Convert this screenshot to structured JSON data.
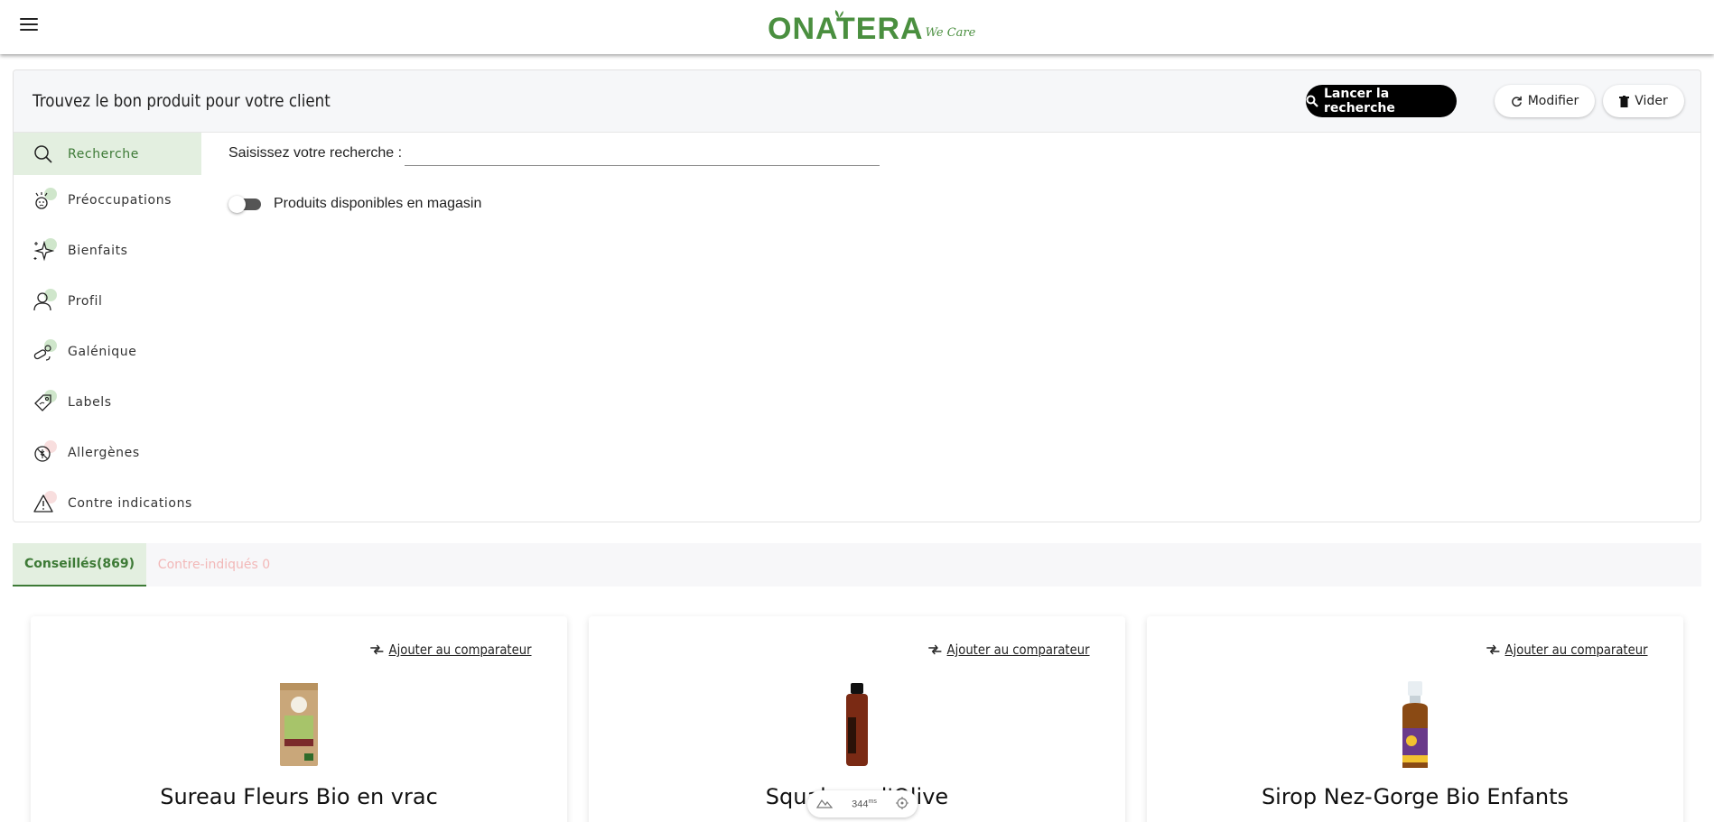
{
  "header": {
    "logo_text": "ONATERA",
    "logo_tagline": "We Care",
    "brand_color": "#4a8f3f"
  },
  "panel": {
    "title": "Trouvez le bon produit pour votre client",
    "search_button": "Lancer la recherche",
    "modify_button": "Modifier",
    "clear_button": "Vider"
  },
  "sidebar": {
    "items": [
      {
        "label": "Recherche",
        "icon": "search-icon",
        "active": true
      },
      {
        "label": "Préoccupations",
        "icon": "concerns-icon"
      },
      {
        "label": "Bienfaits",
        "icon": "sparkle-icon"
      },
      {
        "label": "Profil",
        "icon": "user-icon"
      },
      {
        "label": "Galénique",
        "icon": "capsule-icon"
      },
      {
        "label": "Labels",
        "icon": "tag-icon"
      },
      {
        "label": "Allergènes",
        "icon": "allergen-icon"
      },
      {
        "label": "Contre indications",
        "icon": "warning-icon"
      }
    ]
  },
  "search": {
    "label": "Saisissez votre recherche :",
    "value": "",
    "placeholder": "",
    "toggle_label": "Produits disponibles en magasin",
    "toggle_on": false
  },
  "tabs": {
    "recommended": "Conseillés(869)",
    "contraindicated": "Contre-indiqués 0"
  },
  "products": [
    {
      "compare_label": "Ajouter au comparateur",
      "name": "Sureau Fleurs Bio en vrac"
    },
    {
      "compare_label": "Ajouter au comparateur",
      "name": "Squalane d'Olive"
    },
    {
      "compare_label": "Ajouter au comparateur",
      "name": "Sirop Nez-Gorge Bio Enfants"
    }
  ],
  "perf": {
    "value": "344",
    "unit": "ms"
  }
}
